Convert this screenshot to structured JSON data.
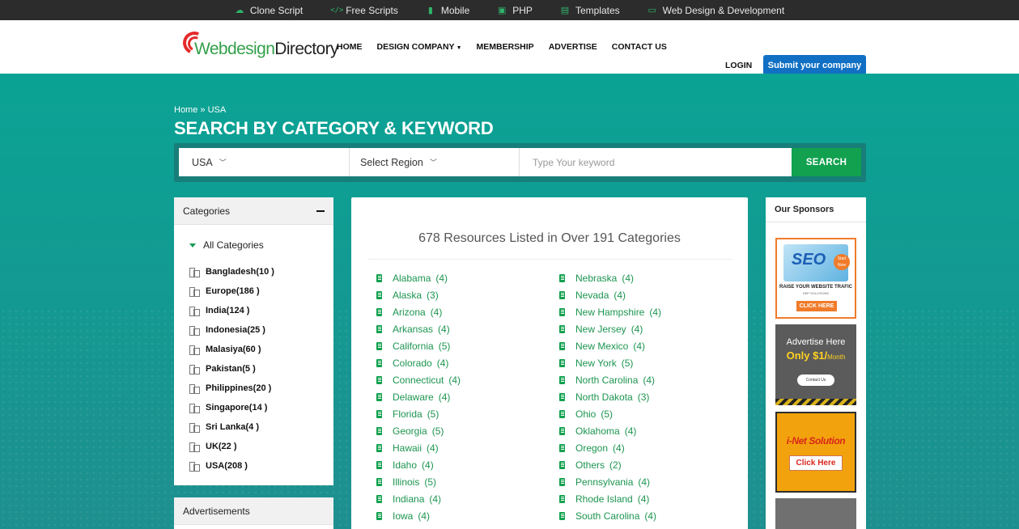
{
  "topbar": {
    "items": [
      {
        "label": "Clone Script",
        "icon": "cloud-icon"
      },
      {
        "label": "Free Scripts",
        "icon": "code-icon"
      },
      {
        "label": "Mobile",
        "icon": "mobile-icon"
      },
      {
        "label": "PHP",
        "icon": "php-icon"
      },
      {
        "label": "Templates",
        "icon": "template-icon"
      },
      {
        "label": "Web Design & Development",
        "icon": "monitor-icon"
      }
    ]
  },
  "header": {
    "logo_part1": "Webdesign",
    "logo_part2": "Directory",
    "nav": [
      "HOME",
      "DESIGN COMPANY",
      "MEMBERSHIP",
      "ADVERTISE",
      "CONTACT US"
    ],
    "login": "LOGIN",
    "submit": "Submit your company"
  },
  "hero": {
    "breadcrumb_home": "Home",
    "breadcrumb_sep": "»",
    "breadcrumb_current": "USA",
    "title": "SEARCH BY CATEGORY & KEYWORD"
  },
  "search": {
    "country": "USA",
    "region": "Select Region",
    "keyword_placeholder": "Type Your keyword",
    "button": "SEARCH"
  },
  "categories": {
    "title": "Categories",
    "all": "All Categories",
    "items": [
      "Bangladesh(10 )",
      "Europe(186 )",
      "India(124 )",
      "Indonesia(25 )",
      "Malasiya(60 )",
      "Pakistan(5 )",
      "Philippines(20 )",
      "Singapore(14 )",
      "Sri Lanka(4 )",
      "UK(22 )",
      "USA(208 )"
    ]
  },
  "ads": {
    "title": "Advertisements"
  },
  "listing": {
    "title": "678 Resources Listed in Over 191 Categories",
    "left": [
      {
        "name": "Alabama",
        "count": "(4)"
      },
      {
        "name": "Alaska",
        "count": "(3)"
      },
      {
        "name": "Arizona",
        "count": "(4)"
      },
      {
        "name": "Arkansas",
        "count": "(4)"
      },
      {
        "name": "California",
        "count": "(5)"
      },
      {
        "name": "Colorado",
        "count": "(4)"
      },
      {
        "name": "Connecticut",
        "count": "(4)"
      },
      {
        "name": "Delaware",
        "count": "(4)"
      },
      {
        "name": "Florida",
        "count": "(5)"
      },
      {
        "name": "Georgia",
        "count": "(5)"
      },
      {
        "name": "Hawaii",
        "count": "(4)"
      },
      {
        "name": "Idaho",
        "count": "(4)"
      },
      {
        "name": "Illinois",
        "count": "(5)"
      },
      {
        "name": "Indiana",
        "count": "(4)"
      },
      {
        "name": "Iowa",
        "count": "(4)"
      }
    ],
    "right": [
      {
        "name": "Nebraska",
        "count": "(4)"
      },
      {
        "name": "Nevada",
        "count": "(4)"
      },
      {
        "name": "New Hampshire",
        "count": "(4)"
      },
      {
        "name": "New Jersey",
        "count": "(4)"
      },
      {
        "name": "New Mexico",
        "count": "(4)"
      },
      {
        "name": "New York",
        "count": "(5)"
      },
      {
        "name": "North Carolina",
        "count": "(4)"
      },
      {
        "name": "North Dakota",
        "count": "(3)"
      },
      {
        "name": "Ohio",
        "count": "(5)"
      },
      {
        "name": "Oklahoma",
        "count": "(4)"
      },
      {
        "name": "Oregon",
        "count": "(4)"
      },
      {
        "name": "Others",
        "count": "(2)"
      },
      {
        "name": "Pennsylvania",
        "count": "(4)"
      },
      {
        "name": "Rhode Island",
        "count": "(4)"
      },
      {
        "name": "South Carolina",
        "count": "(4)"
      }
    ]
  },
  "sponsors": {
    "title": "Our Sponsors",
    "seo": {
      "text": "SEO",
      "badge": "Start Now",
      "line": "RAISE YOUR WEBSITE TRAFIC",
      "sub": "SEP SOLUTIONS",
      "button": "CLICK HERE"
    },
    "advertise": {
      "line1": "Advertise Here",
      "price": "Only $1/",
      "per": "Month",
      "button": "Contact Us"
    },
    "inet": {
      "title": "i-Net Solution",
      "button": "Click Here"
    }
  },
  "colors": {
    "accent_green": "#12a14f",
    "submit_blue": "#1170c4",
    "hero_teal": "#0f9a90",
    "topbar_dark": "#2c2c2c"
  }
}
